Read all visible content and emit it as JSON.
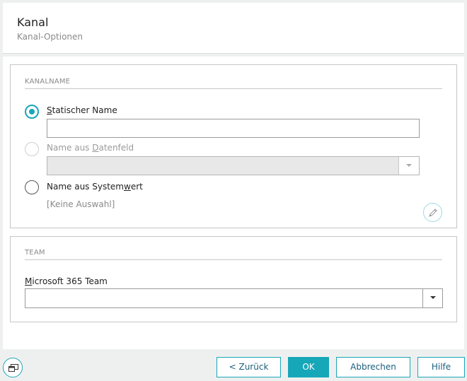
{
  "dialog": {
    "title": "Kanal",
    "subtitle": "Kanal-Optionen"
  },
  "channel_name": {
    "section_title": "KANALNAME",
    "option_static": {
      "label_prefix": "",
      "label_accel": "S",
      "label_rest": "tatischer Name",
      "value": "",
      "selected": true
    },
    "option_datafield": {
      "label_prefix": "Name aus ",
      "label_accel": "D",
      "label_rest": "atenfeld",
      "selected": false,
      "disabled": true
    },
    "option_system": {
      "label_prefix": "Name aus System",
      "label_accel": "w",
      "label_rest": "ert",
      "selected": false,
      "placeholder": "[Keine Auswahl]"
    }
  },
  "team": {
    "section_title": "TEAM",
    "field_label_accel": "M",
    "field_label_rest": "icrosoft 365 Team",
    "selected_value": ""
  },
  "footer": {
    "back_label": "< Zurück",
    "ok_label": "OK",
    "cancel_label": "Abbrechen",
    "help_label": "Hilfe"
  },
  "colors": {
    "accent": "#16a7b8",
    "button_text": "#1b5e7d"
  }
}
